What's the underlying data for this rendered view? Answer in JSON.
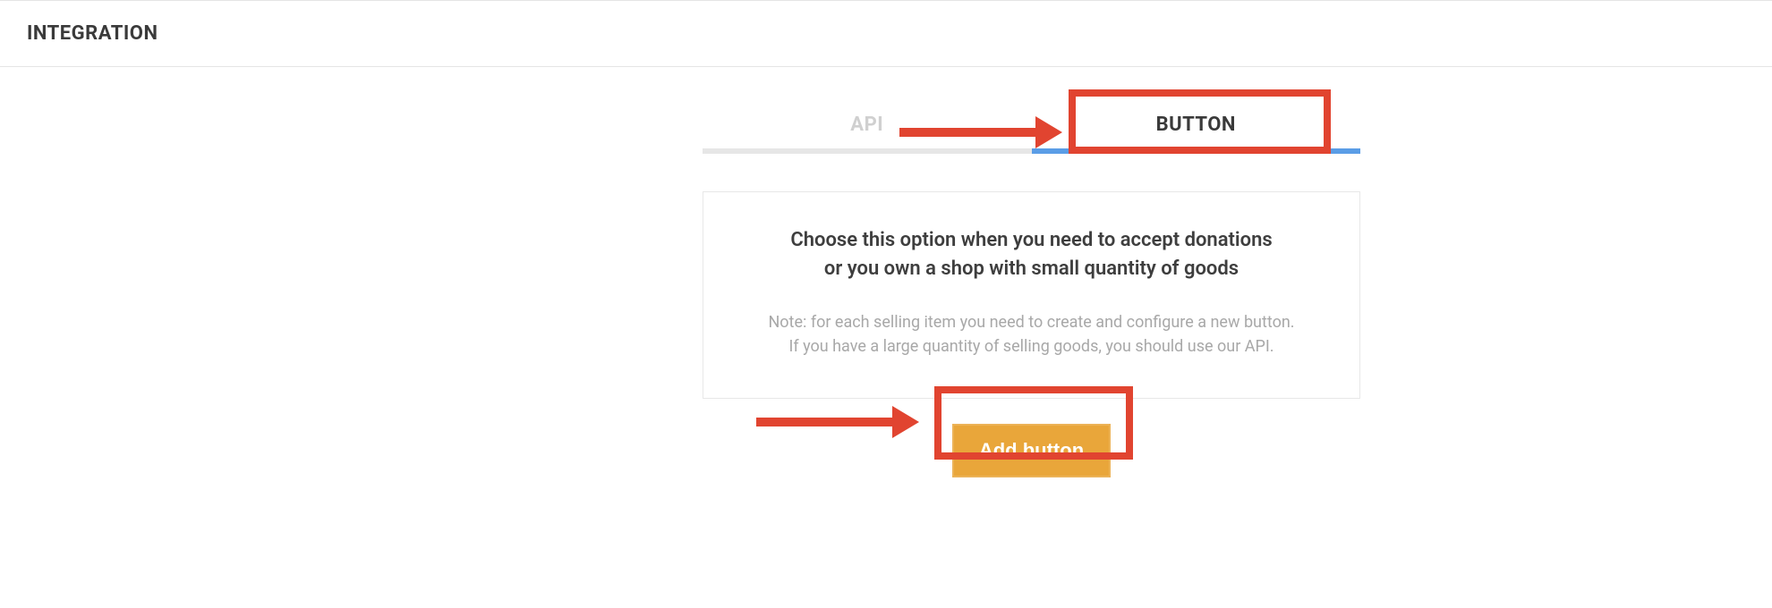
{
  "header": {
    "title": "INTEGRATION"
  },
  "tabs": {
    "api": {
      "label": "API"
    },
    "button": {
      "label": "BUTTON"
    }
  },
  "info": {
    "headline_l1": "Choose this option when you need to accept donations",
    "headline_l2": "or you own a shop with small quantity of goods",
    "note_l1": "Note: for each selling item you need to create and configure a new button.",
    "note_l2": "If you have a large quantity of selling goods, you should use our API."
  },
  "actions": {
    "add_button": "Add button"
  },
  "colors": {
    "accent_orange": "#e9a63a",
    "accent_blue": "#5a9de6",
    "annotation_red": "#e14430"
  }
}
